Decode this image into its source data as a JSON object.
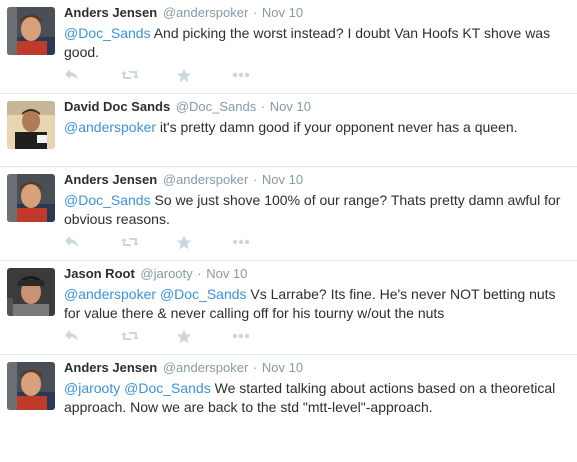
{
  "tweets": [
    {
      "name": "Anders Jensen",
      "handle": "@anderspoker",
      "time": "Nov 10",
      "segments": [
        {
          "type": "mention",
          "text": "@Doc_Sands"
        },
        {
          "type": "text",
          "text": " And picking the worst instead? I doubt Van Hoofs KT shove was good."
        }
      ],
      "has_actions": true,
      "avatar": "anders"
    },
    {
      "name": "David Doc Sands",
      "handle": "@Doc_Sands",
      "time": "Nov 10",
      "segments": [
        {
          "type": "mention",
          "text": "@anderspoker"
        },
        {
          "type": "text",
          "text": " it's pretty damn good if your opponent never has a queen."
        }
      ],
      "has_actions": false,
      "avatar": "david"
    },
    {
      "name": "Anders Jensen",
      "handle": "@anderspoker",
      "time": "Nov 10",
      "segments": [
        {
          "type": "mention",
          "text": "@Doc_Sands"
        },
        {
          "type": "text",
          "text": " So we just shove 100% of our range? Thats pretty damn awful for obvious reasons."
        }
      ],
      "has_actions": true,
      "avatar": "anders"
    },
    {
      "name": "Jason Root",
      "handle": "@jarooty",
      "time": "Nov 10",
      "segments": [
        {
          "type": "mention",
          "text": "@anderspoker"
        },
        {
          "type": "text",
          "text": " "
        },
        {
          "type": "mention",
          "text": "@Doc_Sands"
        },
        {
          "type": "text",
          "text": " Vs Larrabe? Its fine. He's never NOT betting nuts for value there & never calling off for his tourny w/out the nuts"
        }
      ],
      "has_actions": true,
      "avatar": "jason"
    },
    {
      "name": "Anders Jensen",
      "handle": "@anderspoker",
      "time": "Nov 10",
      "segments": [
        {
          "type": "mention",
          "text": "@jarooty"
        },
        {
          "type": "text",
          "text": " "
        },
        {
          "type": "mention",
          "text": "@Doc_Sands"
        },
        {
          "type": "text",
          "text": " We started talking about actions based on a theoretical approach. Now we are back to the std \"mtt-level\"-approach."
        }
      ],
      "has_actions": false,
      "avatar": "anders"
    }
  ],
  "actions": [
    "reply-icon",
    "retweet-icon",
    "favorite-icon",
    "more-icon"
  ],
  "colors": {
    "mention": "#3b94d9",
    "name": "#292f33",
    "meta": "#8899a6",
    "action_icon": "#ccd6dd",
    "divider": "#e1e8ed"
  }
}
